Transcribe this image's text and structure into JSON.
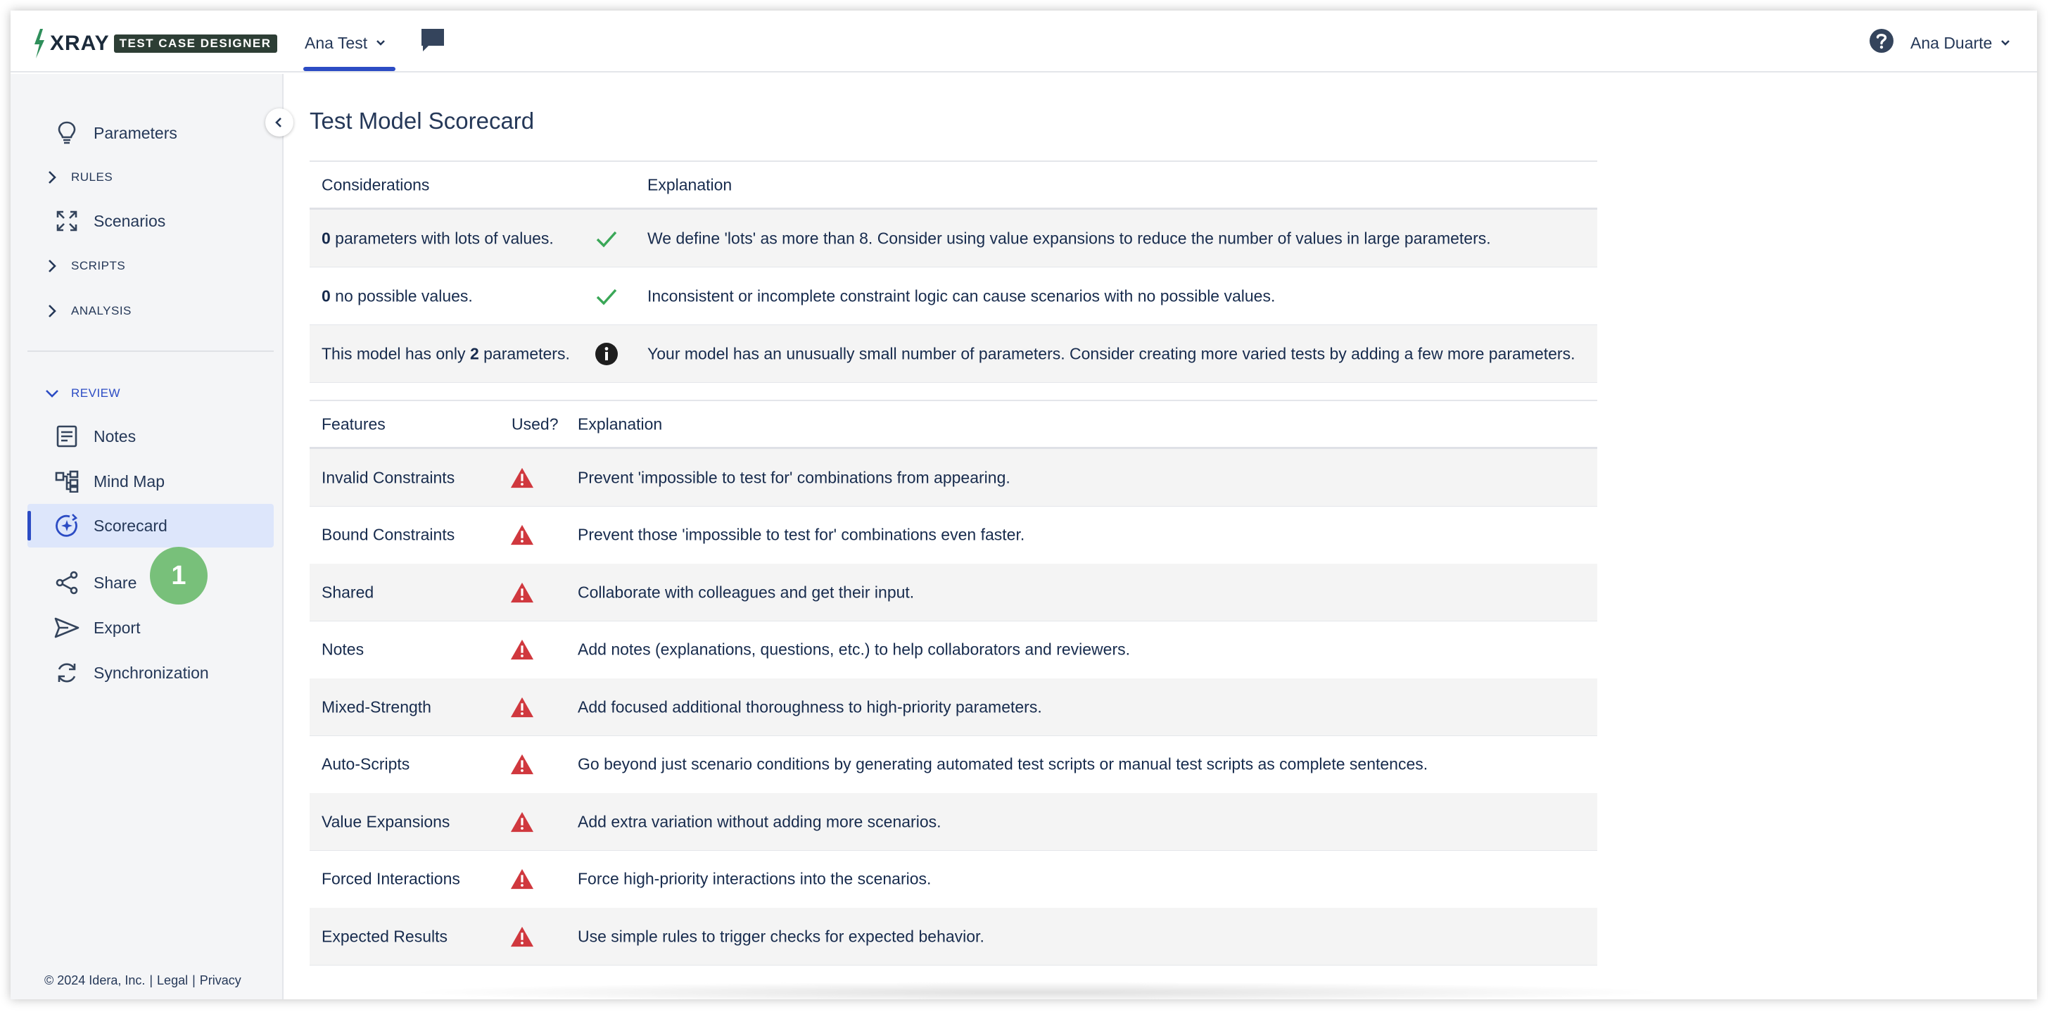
{
  "brand": {
    "logo_main": "XRAY",
    "logo_sub": "TEST CASE DESIGNER"
  },
  "header": {
    "project_name": "Ana Test",
    "user_name": "Ana Duarte"
  },
  "sidebar": {
    "items": {
      "parameters": "Parameters",
      "rules": "RULES",
      "scenarios": "Scenarios",
      "scripts": "SCRIPTS",
      "analysis": "ANALYSIS",
      "review": "REVIEW",
      "notes": "Notes",
      "mind_map": "Mind Map",
      "scorecard": "Scorecard",
      "share": "Share",
      "export": "Export",
      "synchronization": "Synchronization"
    },
    "badge": "1"
  },
  "footer": {
    "copyright": "© 2024 Idera, Inc.",
    "sep": "|",
    "legal": "Legal",
    "privacy": "Privacy"
  },
  "main": {
    "title": "Test Model Scorecard",
    "considerations": {
      "headers": {
        "considerations": "Considerations",
        "explanation": "Explanation"
      },
      "rows": [
        {
          "count": "0",
          "label": " parameters with lots of values.",
          "status": "ok",
          "explanation": "We define 'lots' as more than 8. Consider using value expansions to reduce the number of values in large parameters."
        },
        {
          "count": "0",
          "label": " no possible values.",
          "status": "ok",
          "explanation": "Inconsistent or incomplete constraint logic can cause scenarios with no possible values."
        },
        {
          "prefix": "This model has only ",
          "count": "2",
          "label": " parameters.",
          "status": "info",
          "explanation": "Your model has an unusually small number of parameters. Consider creating more varied tests by adding a few more parameters."
        }
      ]
    },
    "features": {
      "headers": {
        "features": "Features",
        "used": "Used?",
        "explanation": "Explanation"
      },
      "rows": [
        {
          "feature": "Invalid Constraints",
          "status": "warning",
          "explanation": "Prevent 'impossible to test for' combinations from appearing."
        },
        {
          "feature": "Bound Constraints",
          "status": "warning",
          "explanation": "Prevent those 'impossible to test for' combinations even faster."
        },
        {
          "feature": "Shared",
          "status": "warning",
          "explanation": "Collaborate with colleagues and get their input."
        },
        {
          "feature": "Notes",
          "status": "warning",
          "explanation": "Add notes (explanations, questions, etc.) to help collaborators and reviewers."
        },
        {
          "feature": "Mixed-Strength",
          "status": "warning",
          "explanation": "Add focused additional thoroughness to high-priority parameters."
        },
        {
          "feature": "Auto-Scripts",
          "status": "warning",
          "explanation": "Go beyond just scenario conditions by generating automated test scripts or manual test scripts as complete sentences."
        },
        {
          "feature": "Value Expansions",
          "status": "warning",
          "explanation": "Add extra variation without adding more scenarios."
        },
        {
          "feature": "Forced Interactions",
          "status": "warning",
          "explanation": "Force high-priority interactions into the scenarios."
        },
        {
          "feature": "Expected Results",
          "status": "warning",
          "explanation": "Use simple rules to trigger checks for expected behavior."
        }
      ]
    }
  },
  "colors": {
    "accent": "#2c4cc4",
    "ok": "#3aa757",
    "warning": "#d0383e",
    "badge": "#78c07a"
  }
}
